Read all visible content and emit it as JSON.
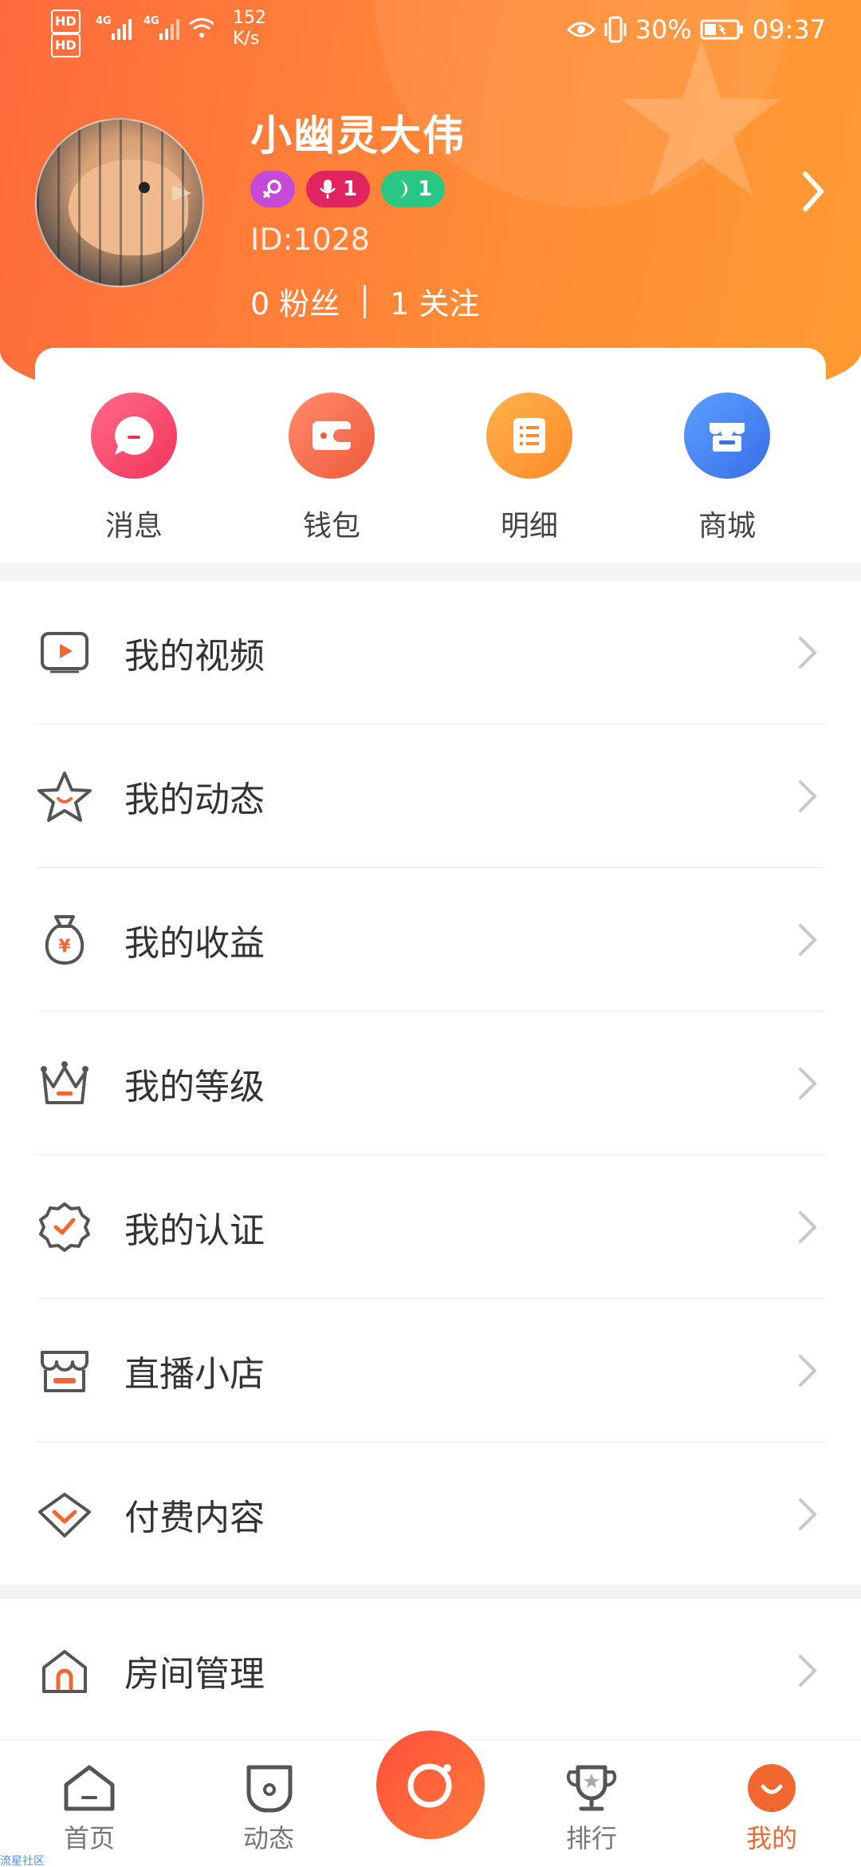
{
  "status_bar": {
    "network_left": [
      "HD",
      "HD"
    ],
    "signal_labels": [
      "4G",
      "4G"
    ],
    "speed_value": "152",
    "speed_unit": "K/s",
    "battery": "30%",
    "time": "09:37"
  },
  "profile": {
    "username": "小幽灵大伟",
    "mic_level": "1",
    "level": "1",
    "user_id": "ID:1028",
    "fans": "0 粉丝",
    "following": "1 关注"
  },
  "quick_actions": [
    {
      "label": "消息",
      "icon": "message-icon",
      "color": "#ff4f7a"
    },
    {
      "label": "钱包",
      "icon": "wallet-icon",
      "color": "#ff6a4e"
    },
    {
      "label": "明细",
      "icon": "list-icon",
      "color": "#ff9a3c"
    },
    {
      "label": "商城",
      "icon": "store-icon",
      "color": "#4a84f0"
    }
  ],
  "menu": [
    {
      "label": "我的视频",
      "icon": "video-icon"
    },
    {
      "label": "我的动态",
      "icon": "star-icon"
    },
    {
      "label": "我的收益",
      "icon": "money-bag-icon"
    },
    {
      "label": "我的等级",
      "icon": "crown-icon"
    },
    {
      "label": "我的认证",
      "icon": "certified-icon"
    },
    {
      "label": "直播小店",
      "icon": "shop-icon"
    },
    {
      "label": "付费内容",
      "icon": "diamond-icon"
    }
  ],
  "menu2": [
    {
      "label": "房间管理",
      "icon": "house-icon"
    }
  ],
  "nav": [
    {
      "label": "首页",
      "icon": "home-icon"
    },
    {
      "label": "动态",
      "icon": "moments-icon"
    },
    {
      "label": "",
      "icon": "camera-live-icon"
    },
    {
      "label": "排行",
      "icon": "trophy-icon"
    },
    {
      "label": "我的",
      "icon": "me-icon"
    }
  ],
  "watermark": "流星社区",
  "colors": {
    "accent": "#f2662f",
    "header_start": "#ff6a3c",
    "header_end": "#ff9b33"
  }
}
